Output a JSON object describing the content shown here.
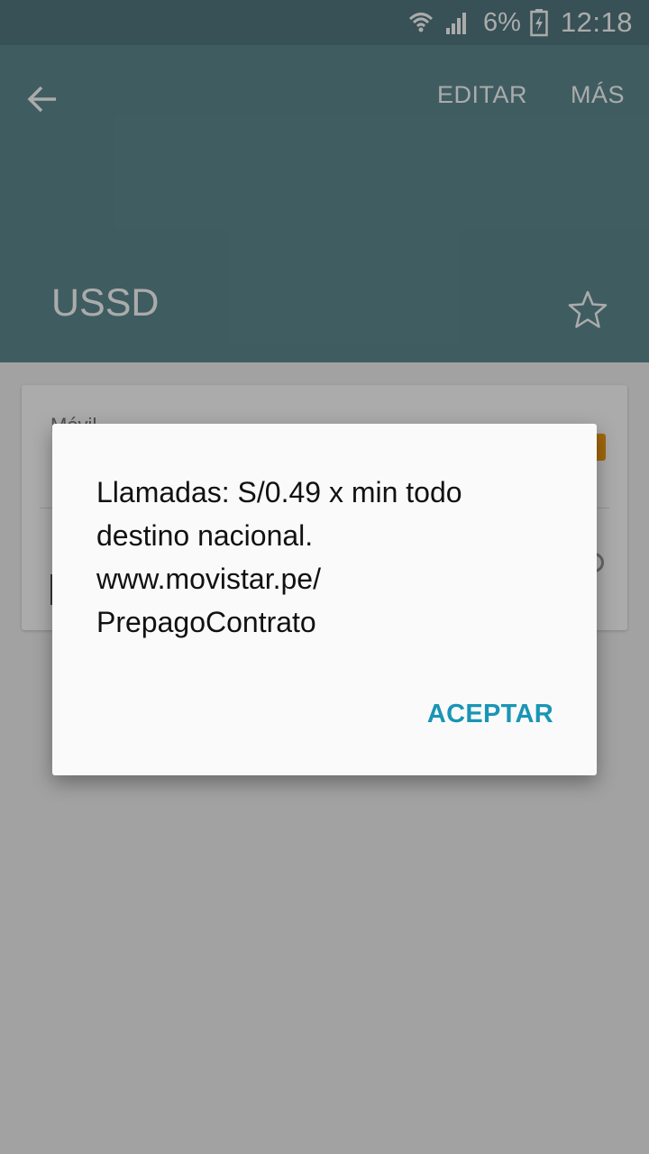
{
  "status_bar": {
    "battery_percent": "6%",
    "time": "12:18",
    "icons": [
      "wifi-icon",
      "signal-icon",
      "battery-charging-icon"
    ]
  },
  "app_bar": {
    "back_icon": "arrow-back-icon",
    "edit_label": "EDITAR",
    "more_label": "MÁS",
    "title": "USSD",
    "favorite_icon": "star-outline-icon"
  },
  "card": {
    "label": "Móvil"
  },
  "dialog": {
    "message_lines": [
      "Llamadas: S/0.49 x min todo",
      "destino nacional.",
      "www.movistar.pe/",
      "PrepagoContrato"
    ],
    "accept_label": "ACEPTAR"
  },
  "colors": {
    "status_bar": "#527a80",
    "app_bar": "#5f8b91",
    "accent": "#1a95b5",
    "dialog_bg": "#fafafa"
  }
}
